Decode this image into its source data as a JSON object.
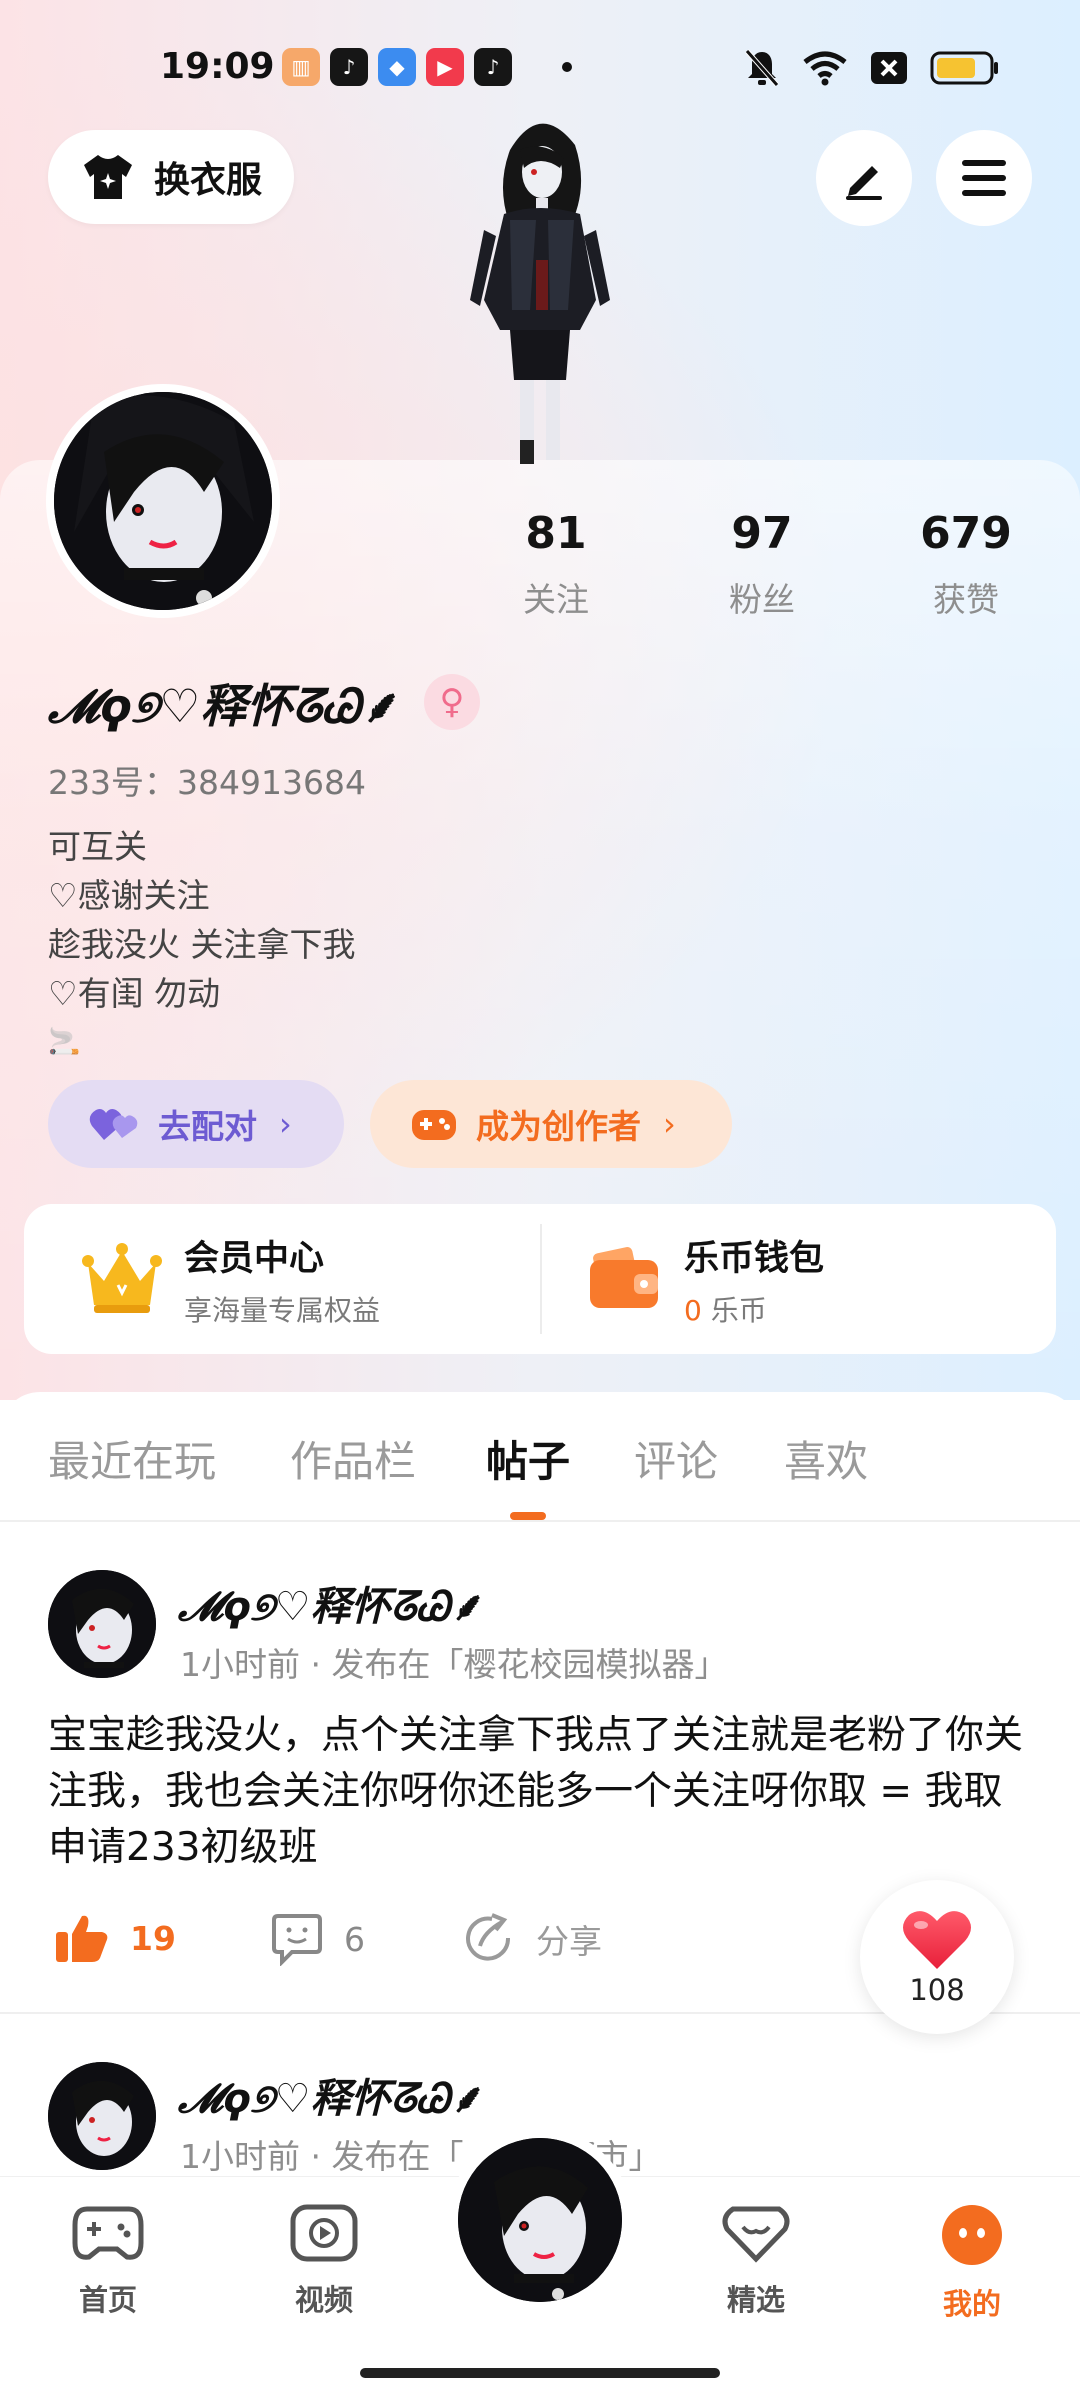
{
  "status_bar": {
    "time": "19:09",
    "apps": [
      "bookshelf-app-icon",
      "tiktok-app-icon",
      "cloud-app-icon",
      "video-app-icon",
      "tiktok-app-icon"
    ],
    "icons": [
      "mute-icon",
      "wifi-icon",
      "close-box-icon",
      "battery-icon"
    ]
  },
  "header": {
    "outfit_label": "换衣服",
    "edit_icon": "pen-icon",
    "menu_icon": "hamburger-icon"
  },
  "profile": {
    "stats": [
      {
        "value": "81",
        "label": "关注"
      },
      {
        "value": "97",
        "label": "粉丝"
      },
      {
        "value": "679",
        "label": "获赞"
      }
    ],
    "username": "𝓜ϙ୭♡释怀ᘔᏊ⸙",
    "gender_symbol": "♀",
    "uid": "233号：384913684",
    "bio": [
      "可互关",
      "♡感谢关注",
      "趁我没火 关注拿下我",
      "♡有闺 勿动",
      "🚬"
    ]
  },
  "actions": {
    "match_label": "去配对",
    "creator_label": "成为创作者",
    "chevron": "›"
  },
  "cards": {
    "member_title": "会员中心",
    "member_sub": "享海量专属权益",
    "wallet_title": "乐币钱包",
    "wallet_amount": "0",
    "wallet_unit": "乐币"
  },
  "tabs": [
    {
      "label": "最近在玩"
    },
    {
      "label": "作品栏"
    },
    {
      "label": "帖子"
    },
    {
      "label": "评论"
    },
    {
      "label": "喜欢"
    }
  ],
  "active_tab": "帖子",
  "posts": [
    {
      "author": "𝓜ϙ୭♡释怀ᘔᏊ⸙",
      "meta": "1小时前 · 发布在「樱花校园模拟器」",
      "text": "宝宝趁我没火，点个关注拿下我点了关注就是老粉了你关注我，我也会关注你呀你还能多一个关注呀你取 = 我取申请233初级班",
      "likes": "19",
      "comments": "6",
      "share_label": "分享"
    },
    {
      "author": "𝓜ϙ୭♡释怀ᘔᏊ⸙",
      "meta": "1小时前 · 发布在「　　　都市」"
    }
  ],
  "float_like": {
    "count": "108"
  },
  "bottom_nav": [
    {
      "label": "首页",
      "icon": "gamepad-icon"
    },
    {
      "label": "视频",
      "icon": "play-icon"
    },
    {
      "label": "",
      "icon": "avatar"
    },
    {
      "label": "精选",
      "icon": "heart-diamond-icon"
    },
    {
      "label": "我的",
      "icon": "face-icon"
    }
  ],
  "colors": {
    "accent": "#F36C1F",
    "match_purple": "#6D5BD2",
    "like_red": "#F2384B",
    "gender_pink": "#F06C8C"
  }
}
